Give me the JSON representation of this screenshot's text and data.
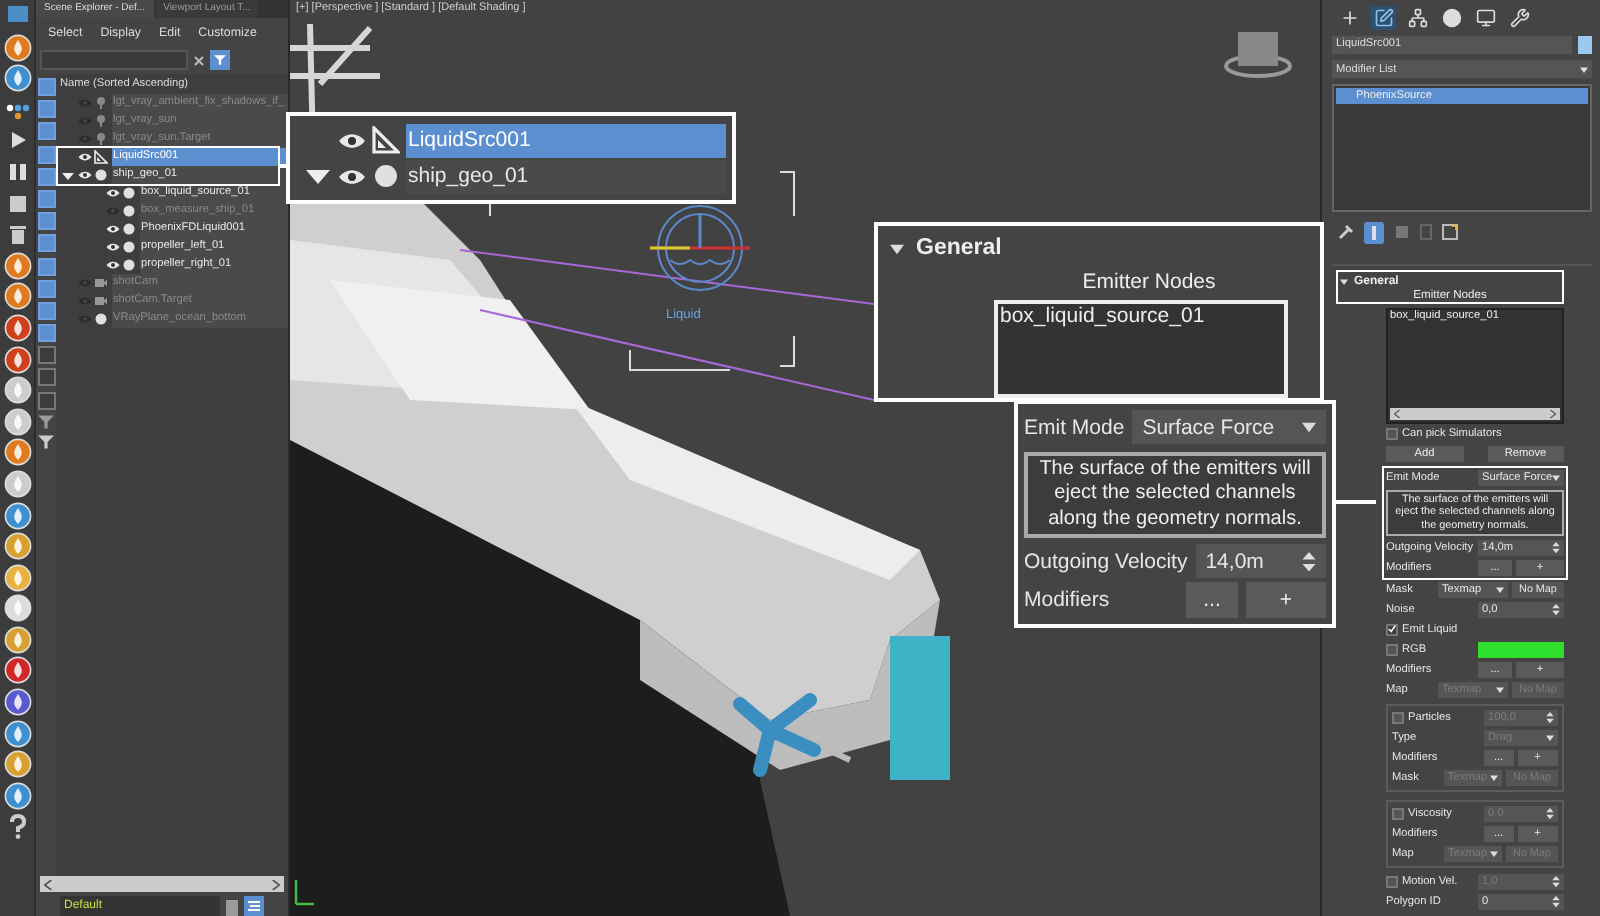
{
  "scene_explorer": {
    "tabs": [
      {
        "label": "Scene Explorer - Def...",
        "selected": true
      },
      {
        "label": "Viewport Layout T...",
        "selected": false
      }
    ],
    "menu": [
      "Select",
      "Display",
      "Edit",
      "Customize"
    ],
    "column_header": "Name (Sorted Ascending)",
    "tree": [
      {
        "name": "lgt_vray_ambient_fix_shadows_if_",
        "kind": "light",
        "visible": false,
        "selected": false
      },
      {
        "name": "lgt_vray_sun",
        "kind": "light",
        "visible": false,
        "selected": false
      },
      {
        "name": "lgt_vray_sun.Target",
        "kind": "light",
        "visible": false,
        "selected": false
      },
      {
        "name": "LiquidSrc001",
        "kind": "helper",
        "visible": true,
        "selected": true
      },
      {
        "name": "ship_geo_01",
        "kind": "geometry",
        "visible": true,
        "selected": false,
        "expanded": true,
        "children": [
          {
            "name": "box_liquid_source_01",
            "kind": "geometry",
            "visible": true,
            "selected": false
          },
          {
            "name": "box_measure_ship_01",
            "kind": "geometry",
            "visible": false,
            "selected": false
          },
          {
            "name": "PhoenixFDLiquid001",
            "kind": "geometry",
            "visible": true,
            "selected": false
          },
          {
            "name": "propeller_left_01",
            "kind": "geometry",
            "visible": true,
            "selected": false
          },
          {
            "name": "propeller_right_01",
            "kind": "geometry",
            "visible": true,
            "selected": false
          }
        ]
      },
      {
        "name": "shotCam",
        "kind": "camera",
        "visible": false,
        "selected": false
      },
      {
        "name": "shotCam.Target",
        "kind": "camera",
        "visible": false,
        "selected": false
      },
      {
        "name": "VRayPlane_ocean_bottom",
        "kind": "geometry",
        "visible": false,
        "selected": false
      }
    ],
    "layer": "Default"
  },
  "viewport": {
    "label": "[+] [Perspective ] [Standard ] [Default Shading ]",
    "gizmo_label": "Liquid"
  },
  "callouts": {
    "explorer": [
      {
        "name": "LiquidSrc001",
        "kind": "helper",
        "visible": true,
        "selected": true
      },
      {
        "name": "ship_geo_01",
        "kind": "geometry",
        "visible": true,
        "selected": false,
        "expanded": true
      }
    ],
    "general": {
      "title": "General",
      "list_label": "Emitter Nodes",
      "nodes": [
        "box_liquid_source_01"
      ]
    },
    "emit": [
      {
        "kind": "select",
        "label": "Emit Mode",
        "value": "Surface Force",
        "disabled": false
      },
      {
        "kind": "note",
        "text": "The surface of the emitters will eject the selected channels along the geometry normals."
      },
      {
        "kind": "spinner",
        "label": "Outgoing Velocity",
        "value": "14,0m",
        "disabled": false
      },
      {
        "kind": "buttons",
        "label": "Modifiers",
        "buttons": [
          "...",
          "+"
        ]
      }
    ]
  },
  "command_panel": {
    "tabs": [
      {
        "kind": "create",
        "selected": false
      },
      {
        "kind": "modify",
        "selected": true
      },
      {
        "kind": "hierarchy",
        "selected": false
      },
      {
        "kind": "motion",
        "selected": false
      },
      {
        "kind": "display",
        "selected": false
      },
      {
        "kind": "utilities",
        "selected": false
      }
    ],
    "object_name": "LiquidSrc001",
    "modifier_list": "Modifier List",
    "stack": [
      {
        "name": "PhoenixSource",
        "selected": true
      }
    ],
    "rollout": {
      "title": "General",
      "list_label": "Emitter Nodes",
      "nodes": [
        "box_liquid_source_01"
      ],
      "can_pick": {
        "label": "Can pick Simulators",
        "checked": false
      },
      "buttons": [
        "Add",
        "Remove"
      ],
      "rows": [
        {
          "kind": "select",
          "label": "Emit Mode",
          "value": "Surface Force",
          "disabled": false
        },
        {
          "kind": "note",
          "text": "The surface of the emitters will eject the selected channels along the geometry normals."
        },
        {
          "kind": "spinner",
          "label": "Outgoing Velocity",
          "value": "14,0m",
          "disabled": false
        },
        {
          "kind": "buttons",
          "label": "Modifiers",
          "buttons": [
            "...",
            "+"
          ]
        },
        {
          "kind": "texmap",
          "label": "Mask",
          "value": "Texmap",
          "map": "No Map",
          "disabled": false
        },
        {
          "kind": "spinner",
          "label": "Noise",
          "value": "0,0",
          "disabled": false
        },
        {
          "kind": "check",
          "label": "Emit Liquid",
          "checked": true
        },
        {
          "kind": "color",
          "label": "RGB",
          "checked": false,
          "color": "#2ee02e"
        },
        {
          "kind": "buttons",
          "label": "Modifiers",
          "buttons": [
            "...",
            "+"
          ]
        },
        {
          "kind": "texmap",
          "label": "Map",
          "value": "Texmap",
          "map": "No Map",
          "disabled": true
        },
        {
          "kind": "group",
          "rows": [
            {
              "kind": "checkspinner",
              "label": "Particles",
              "checked": false,
              "value": "100,0",
              "disabled": true
            },
            {
              "kind": "select",
              "label": "Type",
              "value": "Drag",
              "disabled": true
            },
            {
              "kind": "buttons",
              "label": "Modifiers",
              "buttons": [
                "...",
                "+"
              ]
            },
            {
              "kind": "texmap",
              "label": "Mask",
              "value": "Texmap",
              "map": "No Map",
              "disabled": true
            }
          ]
        },
        {
          "kind": "group",
          "rows": [
            {
              "kind": "checkspinner",
              "label": "Viscosity",
              "checked": false,
              "value": "0,0",
              "disabled": true
            },
            {
              "kind": "buttons",
              "label": "Modifiers",
              "buttons": [
                "...",
                "+"
              ]
            },
            {
              "kind": "texmap",
              "label": "Map",
              "value": "Texmap",
              "map": "No Map",
              "disabled": true
            }
          ]
        },
        {
          "kind": "checkspinner",
          "label": "Motion Vel.",
          "checked": false,
          "value": "1,0",
          "disabled": true
        },
        {
          "kind": "spinner",
          "label": "Polygon ID",
          "value": "0",
          "disabled": false
        }
      ]
    }
  }
}
